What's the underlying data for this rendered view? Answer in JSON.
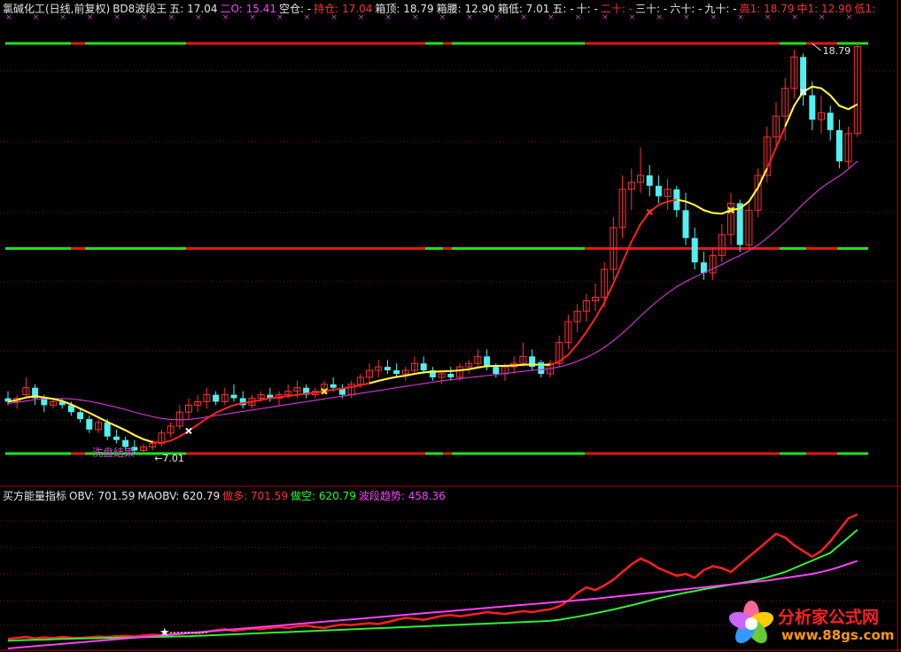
{
  "header_top": {
    "title": "氯碱化工(日线,前复权)",
    "indicator": "BD8波段王",
    "items": [
      {
        "label": "五:",
        "value": "17.04",
        "color": "#e8e8e8"
      },
      {
        "label": "二O:",
        "value": "15.41",
        "color": "#ff40ff"
      },
      {
        "label": "空仓:",
        "value": "-",
        "color": "#e8e8e8"
      },
      {
        "label": "持仓:",
        "value": "17.04",
        "color": "#ff3030"
      },
      {
        "label": "箱顶:",
        "value": "18.79",
        "color": "#e8e8e8"
      },
      {
        "label": "箱腰:",
        "value": "12.90",
        "color": "#e8e8e8"
      },
      {
        "label": "箱低:",
        "value": "7.01",
        "color": "#e8e8e8"
      },
      {
        "label": "五:",
        "value": "-",
        "color": "#e8e8e8"
      },
      {
        "label": "十:",
        "value": "-",
        "color": "#e8e8e8"
      },
      {
        "label": "二十:",
        "value": "-",
        "color": "#ff3030"
      },
      {
        "label": "三十:",
        "value": "-",
        "color": "#e8e8e8"
      },
      {
        "label": "六十:",
        "value": "-",
        "color": "#e8e8e8"
      },
      {
        "label": "九十:",
        "value": "-",
        "color": "#e8e8e8"
      },
      {
        "label": "高1:",
        "value": "18.79",
        "color": "#ff3030"
      },
      {
        "label": "中1:",
        "value": "12.90",
        "color": "#ff3030"
      },
      {
        "label": "低1:",
        "value": "",
        "color": "#ff3030"
      }
    ]
  },
  "header_bottom": {
    "title": "买方能量指标",
    "items": [
      {
        "label": "OBV:",
        "value": "701.59",
        "color": "#e8e8e8"
      },
      {
        "label": "MAOBV:",
        "value": "620.79",
        "color": "#e8e8e8"
      },
      {
        "label": "做多:",
        "value": "701.59",
        "color": "#ff3030"
      },
      {
        "label": "做空:",
        "value": "620.79",
        "color": "#20ff20"
      },
      {
        "label": "波段趋势:",
        "value": "458.36",
        "color": "#ff40ff"
      }
    ]
  },
  "annotations": {
    "high_label": "18.79",
    "low_label": "←7.01",
    "wash_label": "洗盘结束"
  },
  "logo": {
    "text": "分析家公式网",
    "url": "www.88gs.com"
  },
  "colors": {
    "up": "#ff3030",
    "down": "#50f0f0",
    "ma_fast": "#ff2020",
    "ma_slow": "#cc33cc",
    "signal": "#ffff40",
    "box_green": "#20e020",
    "box_red": "#e01818",
    "obv": "#ff2020",
    "maobv": "#30f030",
    "trend": "#ff40ff"
  },
  "chart_data": [
    {
      "type": "candlestick",
      "y_levels": {
        "box_top": 18.79,
        "box_mid": 12.9,
        "box_low": 7.01
      },
      "ylim": [
        5.5,
        19.5
      ],
      "candles": [
        [
          8.6,
          8.8,
          8.4,
          8.5
        ],
        [
          8.5,
          8.7,
          8.3,
          8.6
        ],
        [
          8.7,
          9.2,
          8.6,
          8.9
        ],
        [
          8.9,
          9.0,
          8.4,
          8.6
        ],
        [
          8.6,
          8.7,
          8.2,
          8.4
        ],
        [
          8.4,
          8.6,
          8.3,
          8.5
        ],
        [
          8.5,
          8.6,
          8.3,
          8.4
        ],
        [
          8.4,
          8.5,
          8.1,
          8.2
        ],
        [
          8.2,
          8.3,
          7.9,
          8.0
        ],
        [
          8.0,
          8.1,
          7.6,
          7.7
        ],
        [
          7.7,
          8.0,
          7.6,
          7.9
        ],
        [
          7.9,
          8.0,
          7.4,
          7.5
        ],
        [
          7.5,
          7.7,
          7.3,
          7.4
        ],
        [
          7.4,
          7.5,
          7.1,
          7.2
        ],
        [
          7.2,
          7.4,
          7.0,
          7.1
        ],
        [
          7.1,
          7.3,
          7.0,
          7.2
        ],
        [
          7.2,
          7.4,
          7.1,
          7.3
        ],
        [
          7.3,
          7.7,
          7.2,
          7.6
        ],
        [
          7.6,
          7.9,
          7.5,
          7.8
        ],
        [
          7.8,
          8.4,
          7.7,
          8.2
        ],
        [
          8.2,
          8.6,
          8.0,
          8.4
        ],
        [
          8.4,
          8.7,
          8.2,
          8.5
        ],
        [
          8.5,
          8.9,
          8.3,
          8.7
        ],
        [
          8.7,
          8.8,
          8.4,
          8.5
        ],
        [
          8.5,
          8.9,
          8.4,
          8.7
        ],
        [
          8.7,
          9.0,
          8.5,
          8.6
        ],
        [
          8.6,
          8.8,
          8.3,
          8.4
        ],
        [
          8.4,
          8.7,
          8.3,
          8.6
        ],
        [
          8.6,
          8.8,
          8.5,
          8.7
        ],
        [
          8.7,
          8.9,
          8.5,
          8.6
        ],
        [
          8.6,
          8.8,
          8.4,
          8.7
        ],
        [
          8.7,
          9.0,
          8.6,
          8.8
        ],
        [
          8.8,
          9.1,
          8.6,
          8.9
        ],
        [
          8.9,
          9.0,
          8.6,
          8.7
        ],
        [
          8.7,
          8.9,
          8.6,
          8.8
        ],
        [
          8.8,
          9.1,
          8.7,
          9.0
        ],
        [
          9.0,
          9.2,
          8.8,
          8.9
        ],
        [
          8.9,
          9.0,
          8.6,
          8.7
        ],
        [
          8.7,
          9.1,
          8.6,
          9.0
        ],
        [
          9.0,
          9.3,
          8.9,
          9.2
        ],
        [
          9.2,
          9.6,
          9.0,
          9.4
        ],
        [
          9.4,
          9.7,
          9.2,
          9.5
        ],
        [
          9.5,
          9.7,
          9.3,
          9.4
        ],
        [
          9.4,
          9.6,
          9.2,
          9.3
        ],
        [
          9.3,
          9.5,
          9.1,
          9.4
        ],
        [
          9.4,
          9.8,
          9.3,
          9.6
        ],
        [
          9.6,
          9.8,
          9.3,
          9.4
        ],
        [
          9.4,
          9.5,
          9.1,
          9.2
        ],
        [
          9.2,
          9.4,
          9.0,
          9.3
        ],
        [
          9.3,
          9.5,
          9.1,
          9.2
        ],
        [
          9.2,
          9.6,
          9.1,
          9.5
        ],
        [
          9.5,
          9.7,
          9.3,
          9.6
        ],
        [
          9.6,
          10.0,
          9.5,
          9.8
        ],
        [
          9.8,
          10.0,
          9.4,
          9.5
        ],
        [
          9.5,
          9.6,
          9.2,
          9.3
        ],
        [
          9.3,
          9.6,
          9.1,
          9.5
        ],
        [
          9.5,
          9.8,
          9.3,
          9.6
        ],
        [
          9.6,
          10.2,
          9.5,
          9.8
        ],
        [
          9.8,
          10.0,
          9.4,
          9.5
        ],
        [
          9.5,
          9.7,
          9.2,
          9.3
        ],
        [
          9.3,
          9.7,
          9.2,
          9.6
        ],
        [
          9.6,
          10.4,
          9.5,
          10.2
        ],
        [
          10.2,
          11.0,
          10.0,
          10.8
        ],
        [
          10.8,
          11.3,
          10.5,
          11.1
        ],
        [
          11.1,
          11.6,
          10.8,
          11.4
        ],
        [
          11.4,
          11.9,
          11.1,
          11.5
        ],
        [
          11.5,
          12.5,
          11.2,
          12.3
        ],
        [
          12.3,
          13.8,
          12.0,
          13.5
        ],
        [
          13.5,
          15.0,
          13.2,
          14.6
        ],
        [
          14.6,
          15.2,
          14.0,
          14.8
        ],
        [
          14.8,
          15.8,
          14.5,
          15.0
        ],
        [
          15.0,
          15.3,
          14.4,
          14.7
        ],
        [
          14.7,
          15.0,
          14.2,
          14.4
        ],
        [
          14.4,
          14.9,
          14.0,
          14.6
        ],
        [
          14.6,
          14.7,
          13.8,
          14.0
        ],
        [
          14.0,
          14.5,
          13.0,
          13.2
        ],
        [
          13.2,
          13.5,
          12.3,
          12.5
        ],
        [
          12.5,
          12.8,
          12.0,
          12.2
        ],
        [
          12.2,
          12.9,
          12.0,
          12.7
        ],
        [
          12.7,
          13.6,
          12.5,
          13.3
        ],
        [
          13.3,
          14.5,
          13.0,
          14.2
        ],
        [
          14.2,
          14.3,
          12.8,
          13.0
        ],
        [
          13.0,
          14.2,
          12.9,
          14.0
        ],
        [
          14.0,
          15.2,
          13.8,
          15.0
        ],
        [
          15.0,
          16.4,
          14.8,
          16.1
        ],
        [
          16.1,
          17.1,
          15.8,
          16.7
        ],
        [
          16.7,
          17.8,
          16.0,
          17.5
        ],
        [
          17.5,
          18.6,
          17.2,
          18.4
        ],
        [
          18.4,
          18.5,
          17.0,
          17.3
        ],
        [
          17.3,
          17.7,
          16.3,
          16.6
        ],
        [
          16.6,
          17.3,
          16.2,
          16.8
        ],
        [
          16.8,
          17.0,
          16.0,
          16.3
        ],
        [
          16.3,
          16.6,
          15.2,
          15.4
        ],
        [
          15.4,
          16.4,
          15.2,
          16.2
        ],
        [
          16.2,
          18.8,
          16.1,
          18.7
        ]
      ],
      "ma_fast": [
        8.5,
        8.55,
        8.62,
        8.66,
        8.62,
        8.58,
        8.52,
        8.42,
        8.3,
        8.18,
        8.05,
        7.92,
        7.8,
        7.68,
        7.54,
        7.42,
        7.34,
        7.32,
        7.38,
        7.5,
        7.66,
        7.84,
        8.02,
        8.18,
        8.3,
        8.4,
        8.46,
        8.5,
        8.55,
        8.6,
        8.63,
        8.66,
        8.7,
        8.73,
        8.76,
        8.8,
        8.84,
        8.88,
        8.92,
        8.97,
        9.03,
        9.1,
        9.16,
        9.21,
        9.25,
        9.3,
        9.34,
        9.36,
        9.37,
        9.38,
        9.4,
        9.43,
        9.48,
        9.52,
        9.53,
        9.53,
        9.54,
        9.56,
        9.57,
        9.56,
        9.56,
        9.65,
        9.85,
        10.15,
        10.5,
        10.9,
        11.35,
        11.9,
        12.5,
        13.1,
        13.6,
        13.95,
        14.15,
        14.25,
        14.3,
        14.25,
        14.15,
        14.0,
        13.92,
        13.9,
        14.0,
        14.05,
        14.25,
        14.65,
        15.2,
        15.8,
        16.4,
        17.0,
        17.4,
        17.55,
        17.5,
        17.3,
        17.0,
        16.9,
        17.04
      ],
      "ma_slow": [
        8.45,
        8.48,
        8.52,
        8.56,
        8.58,
        8.59,
        8.59,
        8.58,
        8.55,
        8.51,
        8.46,
        8.4,
        8.34,
        8.27,
        8.2,
        8.13,
        8.07,
        8.02,
        7.99,
        7.98,
        7.99,
        8.02,
        8.06,
        8.1,
        8.14,
        8.18,
        8.22,
        8.26,
        8.3,
        8.34,
        8.38,
        8.42,
        8.46,
        8.5,
        8.54,
        8.58,
        8.62,
        8.66,
        8.7,
        8.74,
        8.78,
        8.82,
        8.86,
        8.9,
        8.94,
        8.98,
        9.02,
        9.06,
        9.1,
        9.13,
        9.16,
        9.19,
        9.22,
        9.25,
        9.28,
        9.31,
        9.34,
        9.37,
        9.4,
        9.42,
        9.45,
        9.5,
        9.57,
        9.66,
        9.77,
        9.9,
        10.06,
        10.25,
        10.47,
        10.71,
        10.96,
        11.2,
        11.42,
        11.62,
        11.8,
        11.95,
        12.08,
        12.2,
        12.32,
        12.44,
        12.58,
        12.7,
        12.84,
        13.0,
        13.2,
        13.42,
        13.66,
        13.92,
        14.18,
        14.42,
        14.64,
        14.82,
        14.98,
        15.18,
        15.41
      ],
      "yellow_segments": [
        [
          0,
          16
        ],
        [
          40,
          60
        ],
        [
          74,
          84
        ],
        [
          86,
          95
        ]
      ],
      "signals": [
        {
          "i": 17,
          "type": "low_7.01"
        },
        {
          "i": 71,
          "type": "x",
          "color": "#ff3030"
        },
        {
          "i": 80,
          "type": "x",
          "color": "#ffff40"
        },
        {
          "i": 88,
          "type": "x",
          "color": "#ffffff"
        },
        {
          "i": 35,
          "type": "x",
          "color": "#ffff40"
        },
        {
          "i": 59,
          "type": "x",
          "color": "#40ffff"
        },
        {
          "i": 20,
          "type": "x",
          "color": "#ffffff"
        }
      ]
    },
    {
      "type": "line",
      "title": "买方能量指标",
      "ylim": [
        0,
        760
      ],
      "series": [
        {
          "name": "做多",
          "values": [
            50,
            55,
            60,
            52,
            58,
            54,
            60,
            56,
            55,
            58,
            62,
            60,
            64,
            66,
            62,
            68,
            72,
            70,
            75,
            78,
            82,
            80,
            88,
            95,
            100,
            92,
            98,
            105,
            100,
            108,
            112,
            108,
            115,
            120,
            112,
            108,
            118,
            125,
            122,
            128,
            132,
            128,
            138,
            150,
            160,
            155,
            150,
            160,
            170,
            175,
            168,
            175,
            182,
            190,
            185,
            180,
            188,
            195,
            190,
            198,
            205,
            220,
            250,
            290,
            320,
            305,
            330,
            360,
            400,
            440,
            470,
            450,
            420,
            400,
            380,
            390,
            370,
            410,
            430,
            420,
            400,
            440,
            480,
            520,
            560,
            600,
            580,
            540,
            510,
            480,
            510,
            560,
            620,
            680,
            701.59
          ]
        },
        {
          "name": "做空",
          "values": [
            40,
            42,
            44,
            45,
            46,
            48,
            50,
            51,
            52,
            53,
            54,
            55,
            56,
            57,
            58,
            59,
            60,
            61,
            62,
            63,
            64,
            66,
            68,
            70,
            72,
            74,
            76,
            78,
            80,
            82,
            84,
            86,
            88,
            90,
            92,
            94,
            96,
            98,
            100,
            102,
            104,
            106,
            108,
            110,
            112,
            114,
            116,
            118,
            120,
            122,
            124,
            126,
            128,
            130,
            132,
            134,
            136,
            138,
            140,
            142,
            145,
            150,
            158,
            166,
            175,
            184,
            194,
            204,
            215,
            226,
            238,
            250,
            262,
            272,
            282,
            292,
            300,
            310,
            318,
            326,
            334,
            342,
            350,
            360,
            372,
            386,
            400,
            420,
            440,
            460,
            480,
            500,
            540,
            580,
            620.79
          ]
        },
        {
          "name": "波段趋势",
          "values": [
            0,
            4,
            8,
            12,
            16,
            20,
            24,
            28,
            32,
            36,
            40,
            44,
            48,
            52,
            56,
            60,
            64,
            68,
            72,
            76,
            80,
            84,
            88,
            92,
            96,
            100,
            104,
            108,
            112,
            116,
            120,
            124,
            128,
            132,
            136,
            140,
            144,
            148,
            152,
            156,
            160,
            164,
            168,
            172,
            176,
            180,
            184,
            188,
            192,
            196,
            200,
            204,
            208,
            212,
            216,
            220,
            224,
            228,
            232,
            236,
            240,
            244,
            248,
            252,
            256,
            260,
            265,
            270,
            275,
            280,
            285,
            290,
            295,
            300,
            305,
            310,
            315,
            320,
            325,
            330,
            335,
            340,
            345,
            350,
            355,
            362,
            369,
            376,
            383,
            390,
            400,
            412,
            426,
            442,
            458.36
          ]
        }
      ]
    }
  ]
}
